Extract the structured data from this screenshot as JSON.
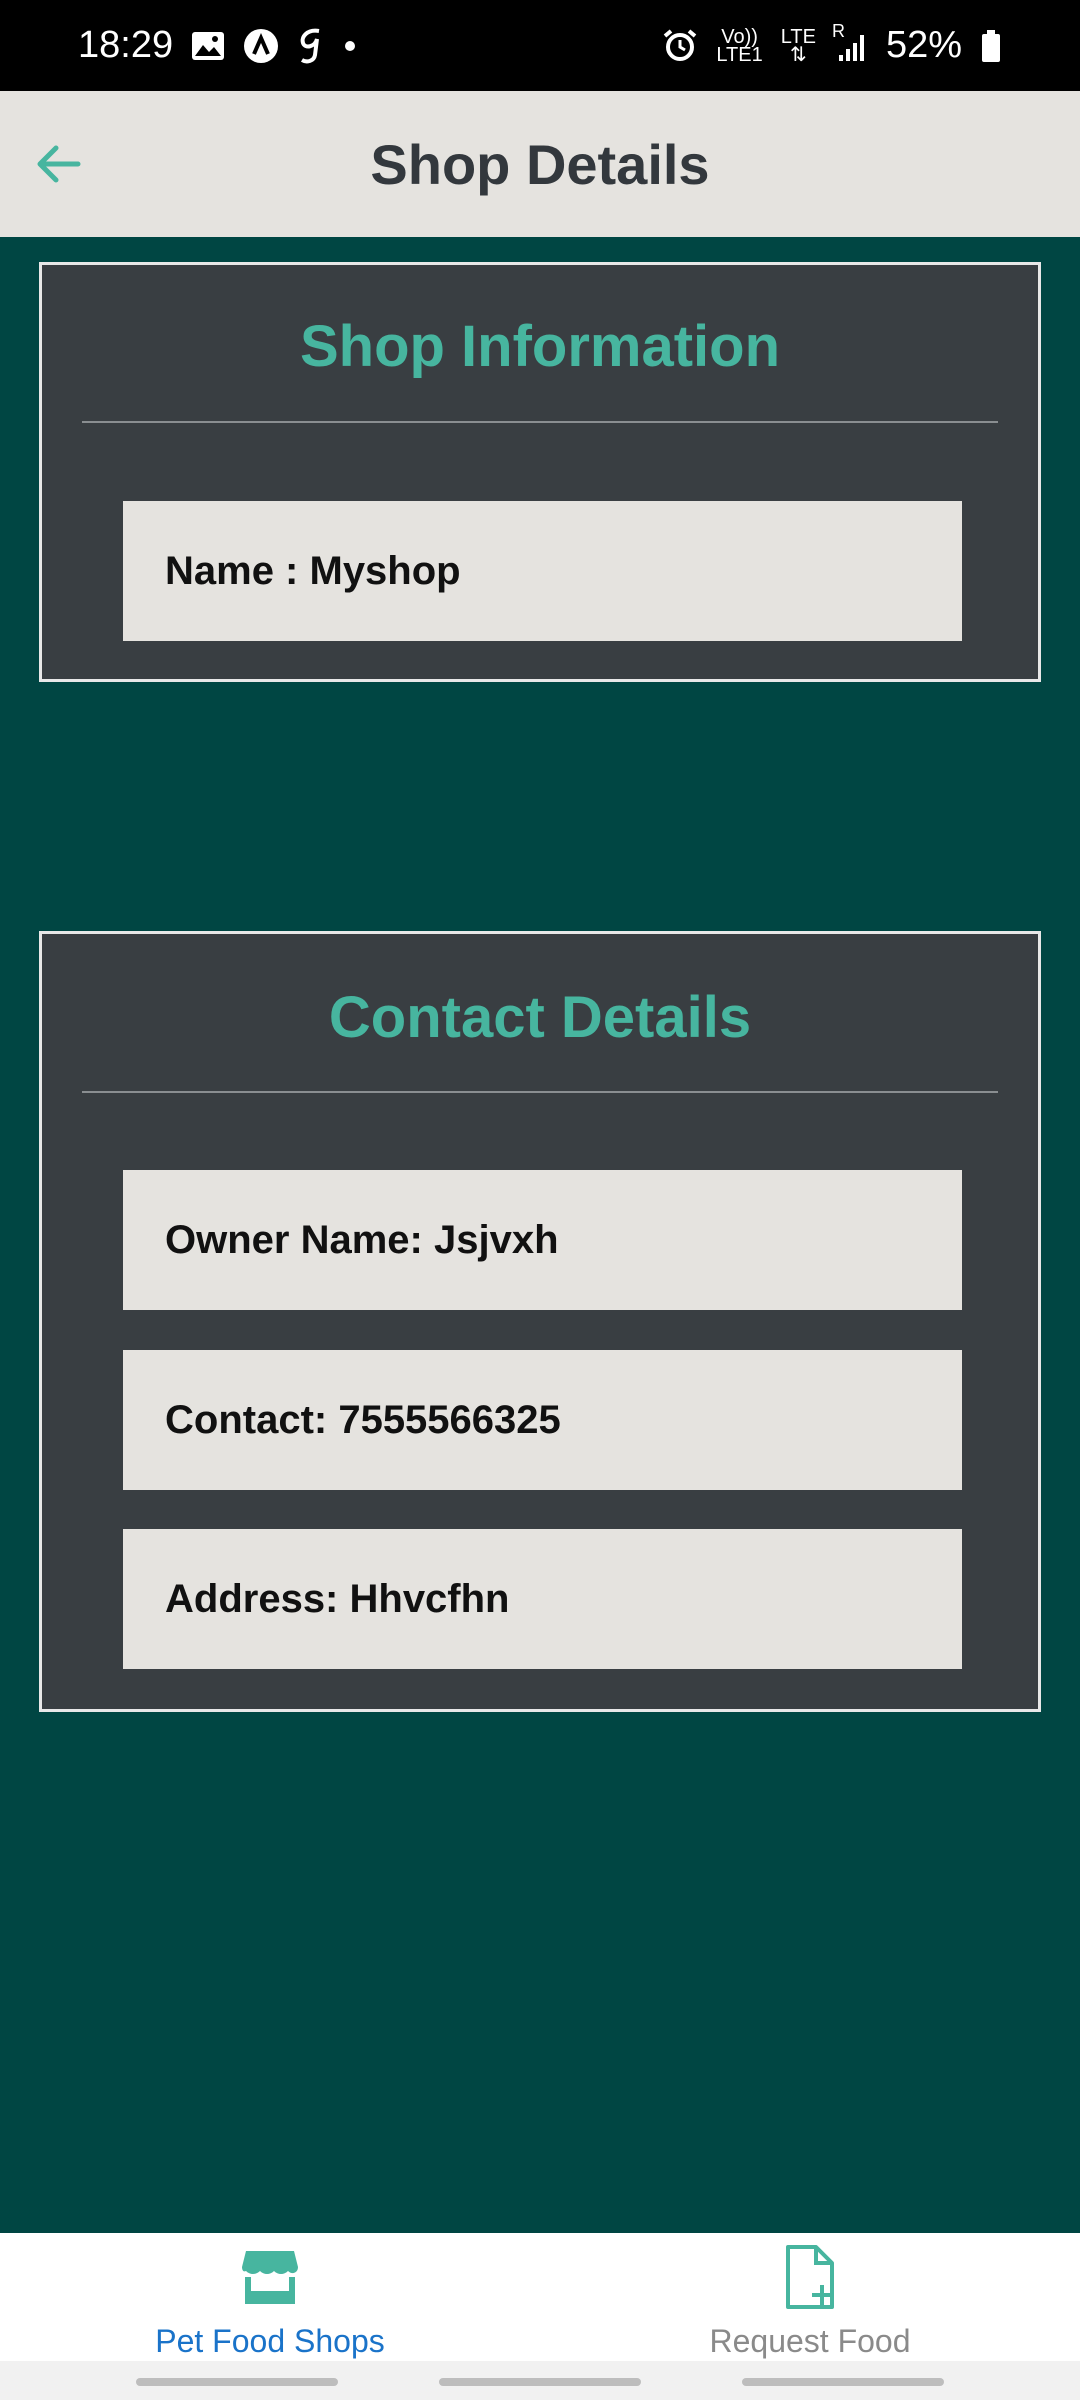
{
  "status_bar": {
    "time": "18:29",
    "left_icons": [
      "image-icon",
      "a-circle-icon",
      "g-icon",
      "dot-icon"
    ],
    "network_text_top": "Vo))",
    "network_text_bottom": "LTE1",
    "lte_text": "LTE",
    "roaming": "R",
    "battery": "52%"
  },
  "app_bar": {
    "title": "Shop Details"
  },
  "shop_info": {
    "title": "Shop Information",
    "name_field": "Name : Myshop"
  },
  "contact": {
    "title": "Contact Details",
    "owner_field": "Owner Name: Jsjvxh",
    "contact_field": "Contact: 7555566325",
    "address_field": "Address: Hhvcfhn"
  },
  "bottom_nav": {
    "items": [
      {
        "label": "Pet Food Shops",
        "icon": "store-icon",
        "active": true
      },
      {
        "label": "Request Food",
        "icon": "file-add-icon",
        "active": false
      }
    ]
  },
  "colors": {
    "background": "#004643",
    "card": "#393e42",
    "accent": "#47b59f",
    "field": "#e5e3df",
    "active_nav": "#1a73c9"
  }
}
